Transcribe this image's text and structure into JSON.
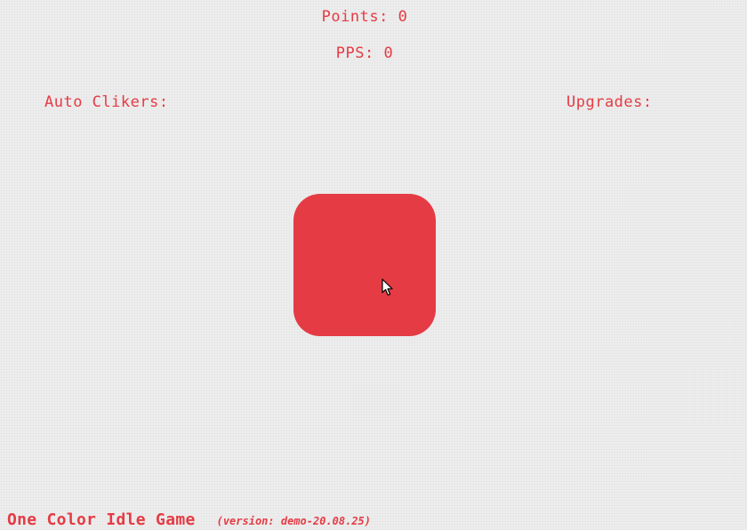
{
  "stats": {
    "points_label": "Points:",
    "points_value": "0",
    "pps_label": "PPS:",
    "pps_value": "0"
  },
  "panels": {
    "auto_clickers_title": "Auto Clikers:",
    "upgrades_title": "Upgrades:"
  },
  "clicker": {
    "color": "#e53b44"
  },
  "footer": {
    "title": "One Color Idle Game",
    "version": "(version: demo-20.08.25)"
  },
  "icons": {
    "cursor": "mouse-pointer-icon"
  }
}
